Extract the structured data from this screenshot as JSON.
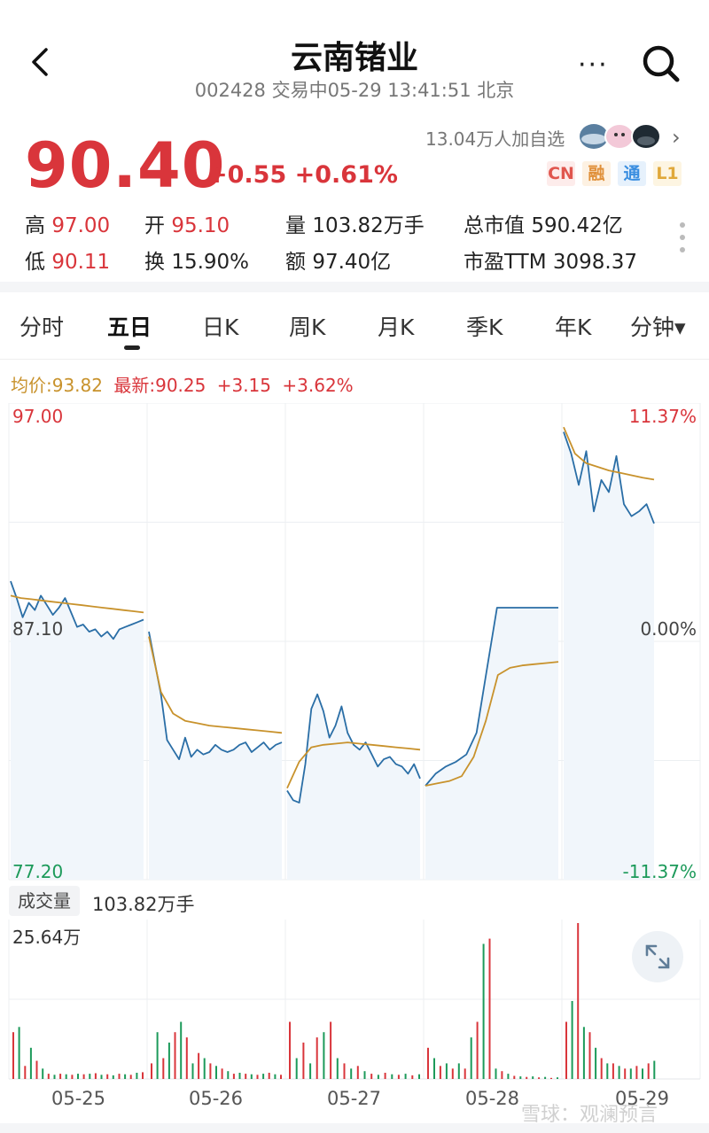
{
  "header": {
    "title": "云南锗业",
    "subtitle": "002428 交易中05-29 13:41:51 北京",
    "more_label": "···"
  },
  "quote": {
    "price": "90.40",
    "change": "+0.55 +0.61%",
    "followers": "13.04万人加自选",
    "badges": [
      {
        "label": "CN",
        "color": "#e0564e",
        "bg": "#fdeceb"
      },
      {
        "label": "融",
        "color": "#e0903a",
        "bg": "#fdf1e2"
      },
      {
        "label": "通",
        "color": "#3a8ee0",
        "bg": "#e6f1fc"
      },
      {
        "label": "L1",
        "color": "#e0a83a",
        "bg": "#fdf5e2"
      }
    ]
  },
  "stats": {
    "high_label": "高",
    "high": "97.00",
    "open_label": "开",
    "open": "95.10",
    "vol_label": "量",
    "vol": "103.82万手",
    "mcap_label": "总市值",
    "mcap": "590.42亿",
    "low_label": "低",
    "low": "90.11",
    "turn_label": "换",
    "turn": "15.90%",
    "amt_label": "额",
    "amt": "97.40亿",
    "pe_label": "市盈TTM",
    "pe": "3098.37"
  },
  "tabs": [
    "分时",
    "五日",
    "日K",
    "周K",
    "月K",
    "季K",
    "年K",
    "分钟▾"
  ],
  "active_tab": "五日",
  "chart_legend": {
    "avg": "均价:93.82",
    "latest": "最新:90.25",
    "chg": "+3.15",
    "pct": "+3.62%"
  },
  "chart_data": {
    "type": "line",
    "days": [
      "05-25",
      "05-26",
      "05-27",
      "05-28",
      "05-29"
    ],
    "ylim": [
      77.2,
      97.0
    ],
    "y_ticks_left": [
      "97.00",
      "87.10",
      "77.20"
    ],
    "y_ticks_right": [
      "11.37%",
      "0.00%",
      "-11.37%"
    ],
    "series": [
      {
        "kind": "price",
        "color": "#2a6ea6",
        "days": [
          [
            89.6,
            88.9,
            88.1,
            88.7,
            88.4,
            89.0,
            88.6,
            88.2,
            88.5,
            88.9,
            88.3,
            87.7,
            87.8,
            87.5,
            87.6,
            87.3,
            87.5,
            87.2,
            87.6,
            87.7,
            87.8,
            87.9,
            88.0
          ],
          [
            87.5,
            86.2,
            84.9,
            83.0,
            82.6,
            82.2,
            83.1,
            82.3,
            82.6,
            82.4,
            82.5,
            82.8,
            82.6,
            82.5,
            82.6,
            82.8,
            82.9,
            82.5,
            82.7,
            82.9,
            82.6,
            82.8,
            82.9
          ],
          [
            80.9,
            80.5,
            80.4,
            82.0,
            84.3,
            84.9,
            84.2,
            83.1,
            83.6,
            84.4,
            83.3,
            82.8,
            82.6,
            82.9,
            82.4,
            81.9,
            82.2,
            82.3,
            82.0,
            81.9,
            81.6,
            82.0,
            81.4
          ],
          [
            81.1,
            81.6,
            81.9,
            82.1,
            82.4,
            83.3,
            85.9,
            88.5,
            88.5,
            88.5,
            88.5,
            88.5,
            88.5,
            88.5
          ],
          [
            95.8,
            94.9,
            93.6,
            95.0,
            92.5,
            93.8,
            93.3,
            94.8,
            92.8,
            92.3,
            92.5,
            92.8,
            92.0
          ]
        ]
      },
      {
        "kind": "avg",
        "color": "#c8922c",
        "days": [
          [
            89.0,
            88.9,
            88.85,
            88.8,
            88.75,
            88.7,
            88.65,
            88.6,
            88.55,
            88.5,
            88.45,
            88.4,
            88.35,
            88.3
          ],
          [
            87.3,
            85.0,
            84.1,
            83.8,
            83.7,
            83.6,
            83.55,
            83.5,
            83.45,
            83.4,
            83.35,
            83.3
          ],
          [
            81.0,
            82.1,
            82.7,
            82.8,
            82.85,
            82.9,
            82.85,
            82.8,
            82.75,
            82.7,
            82.65,
            82.6
          ],
          [
            81.1,
            81.2,
            81.3,
            81.5,
            82.3,
            83.8,
            85.7,
            86.0,
            86.1,
            86.15,
            86.2,
            86.25
          ],
          [
            96.0,
            94.9,
            94.5,
            94.35,
            94.2,
            94.1,
            94.0,
            93.9,
            93.82
          ]
        ]
      }
    ],
    "volume": {
      "label": "成交量",
      "total": "103.82万手",
      "max_label": "25.64万",
      "max": 25.64,
      "bars": [
        [
          0.9,
          1.0,
          0.25,
          0.6,
          0.35,
          0.2,
          0.1,
          0.08,
          0.1,
          0.09,
          0.08,
          0.1,
          0.09,
          0.1,
          0.11,
          0.08,
          0.09,
          0.07,
          0.1,
          0.09,
          0.08,
          0.12,
          0.13
        ],
        [
          0.3,
          0.9,
          0.4,
          0.7,
          0.9,
          1.1,
          0.8,
          0.3,
          0.5,
          0.4,
          0.3,
          0.25,
          0.2,
          0.15,
          0.1,
          0.12,
          0.1,
          0.09,
          0.08,
          0.1,
          0.12,
          0.09,
          0.08
        ],
        [
          1.1,
          0.4,
          0.7,
          0.3,
          0.8,
          0.9,
          1.1,
          0.4,
          0.3,
          0.2,
          0.25,
          0.15,
          0.1,
          0.08,
          0.12,
          0.09,
          0.08,
          0.1,
          0.07,
          0.09
        ],
        [
          0.6,
          0.4,
          0.25,
          0.3,
          0.2,
          0.3,
          0.2,
          0.8,
          1.1,
          2.6,
          2.7,
          0.2,
          0.15,
          0.1,
          0.06,
          0.05,
          0.04,
          0.05,
          0.03,
          0.04,
          0.02,
          0.03
        ],
        [
          1.1,
          1.5,
          3.0,
          1.0,
          0.9,
          0.6,
          0.4,
          0.3,
          0.3,
          0.25,
          0.2,
          0.2,
          0.25,
          0.2,
          0.3,
          0.35
        ]
      ]
    }
  },
  "watermark": "雪球：观澜预言"
}
